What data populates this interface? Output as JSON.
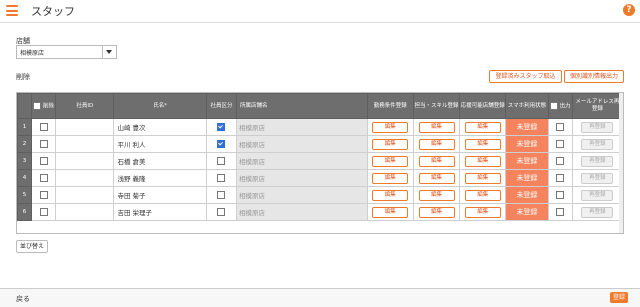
{
  "header": {
    "title": "スタッフ"
  },
  "store": {
    "label": "店舗",
    "selected": "相模原店"
  },
  "actions": {
    "delete": "削除",
    "registered_import": "登録済みスタッフ取込",
    "individual_output": "個別識別情報出力"
  },
  "table": {
    "headers": {
      "delete": "削除",
      "staff_id": "社員ID",
      "name": "氏名*",
      "employee_type": "社員区分",
      "store": "所属店舗名",
      "work_conditions": "勤務条件登録",
      "skills": "担当・スキル登録",
      "help_stores": "応援可能店舗登録",
      "smartphone": "スマホ利用状態",
      "output": "出力",
      "mail": "メールアドレス再登録"
    },
    "cell_labels": {
      "edit": "編集",
      "rereg": "再登録"
    },
    "rows": [
      {
        "num": "1",
        "name": "山崎 豊次",
        "employee": true,
        "store": "相模原店",
        "status": "未登録"
      },
      {
        "num": "2",
        "name": "平川 利人",
        "employee": true,
        "store": "相模原店",
        "status": "未登録"
      },
      {
        "num": "3",
        "name": "石橋 倉美",
        "employee": false,
        "store": "相模原店",
        "status": "未登録"
      },
      {
        "num": "4",
        "name": "浅野 義隆",
        "employee": false,
        "store": "相模原店",
        "status": "未登録"
      },
      {
        "num": "5",
        "name": "寺田 菊子",
        "employee": false,
        "store": "相模原店",
        "status": "未登録"
      },
      {
        "num": "6",
        "name": "吉田 栄理子",
        "employee": false,
        "store": "相模原店",
        "status": "未登録"
      }
    ]
  },
  "sort": {
    "label": "並び替え"
  },
  "footer": {
    "back": "戻る",
    "register": "登録"
  },
  "colors": {
    "accent": "#f07a2c",
    "unregistered": "#f5845e",
    "header_bg": "#6e6e6e"
  }
}
